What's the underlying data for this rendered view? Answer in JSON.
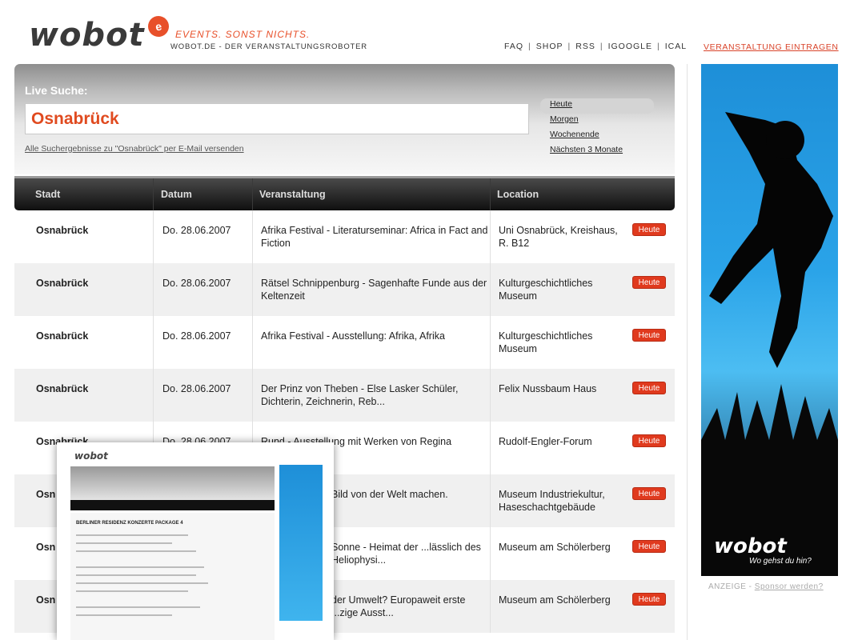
{
  "header": {
    "logo_text": "wobot",
    "logo_badge": "e",
    "tagline": "EVENTS. SONST NICHTS.",
    "subline": "WOBOT.DE - DER VERANSTALTUNGSROBOTER",
    "nav": [
      "FAQ",
      "SHOP",
      "RSS",
      "IGOOGLE",
      "ICAL"
    ],
    "nav_sep": "|",
    "submit_link": "VERANSTALTUNG EINTRAGEN"
  },
  "search": {
    "title": "Live Suche:",
    "query": "Osnabrück",
    "email_link": "Alle Suchergebnisse zu \"Osnabrück\" per E-Mail versenden",
    "time_filters": [
      {
        "label": "Heute",
        "active": true
      },
      {
        "label": "Morgen",
        "active": false
      },
      {
        "label": "Wochenende",
        "active": false
      },
      {
        "label": "Nächsten 3 Monate",
        "active": false
      }
    ]
  },
  "table": {
    "columns": [
      "Stadt",
      "Datum",
      "Veranstaltung",
      "Location"
    ],
    "rows": [
      {
        "stadt": "Osnabrück",
        "datum": "Do. 28.06.2007",
        "veranstaltung": "Afrika Festival - Literaturseminar: Africa in Fact and Fiction",
        "location": "Uni Osnabrück, Kreishaus, R. B12",
        "badge": "Heute"
      },
      {
        "stadt": "Osnabrück",
        "datum": "Do. 28.06.2007",
        "veranstaltung": "Rätsel Schnippenburg - Sagenhafte Funde aus der Keltenzeit",
        "location": "Kulturgeschichtliches Museum",
        "badge": "Heute"
      },
      {
        "stadt": "Osnabrück",
        "datum": "Do. 28.06.2007",
        "veranstaltung": "Afrika Festival - Ausstellung: Afrika, Afrika",
        "location": "Kulturgeschichtliches Museum",
        "badge": "Heute"
      },
      {
        "stadt": "Osnabrück",
        "datum": "Do. 28.06.2007",
        "veranstaltung": "Der Prinz von Theben - Else Lasker Schüler, Dichterin, Zeichnerin, Reb...",
        "location": "Felix Nussbaum Haus",
        "badge": "Heute"
      },
      {
        "stadt": "Osnabrück",
        "datum": "Do. 28.06.2007",
        "veranstaltung": "Rund - Ausstellung mit Werken von Regina",
        "location": "Rudolf-Engler-Forum",
        "badge": "Heute"
      },
      {
        "stadt": "Osn",
        "datum": "",
        "veranstaltung": "Bild von der Welt machen.",
        "location": "Museum Industriekultur, Haseschachtgebäude",
        "badge": "Heute"
      },
      {
        "stadt": "Osn",
        "datum": "",
        "veranstaltung": "Sonne - Heimat der ...lässlich des Heliophysi...",
        "location": "Museum am Schölerberg",
        "badge": "Heute"
      },
      {
        "stadt": "Osn",
        "datum": "",
        "veranstaltung": "der Umwelt? Europaweit erste ...zige Ausst...",
        "location": "Museum am Schölerberg",
        "badge": "Heute"
      }
    ]
  },
  "sponsor": {
    "banner_logo": "wobot",
    "banner_slogan": "Wo gehst du hin?",
    "label": "ANZEIGE - ",
    "link": "Sponsor werden?"
  },
  "thumbnail": {
    "logo": "wobot",
    "title": "BERLINER RESIDENZ KONZERTE PACKAGE 4"
  },
  "colors": {
    "accent": "#e04a1f",
    "badge": "#e03a1e",
    "header_dark": "#111111",
    "banner_blue": "#2aa3e8"
  }
}
